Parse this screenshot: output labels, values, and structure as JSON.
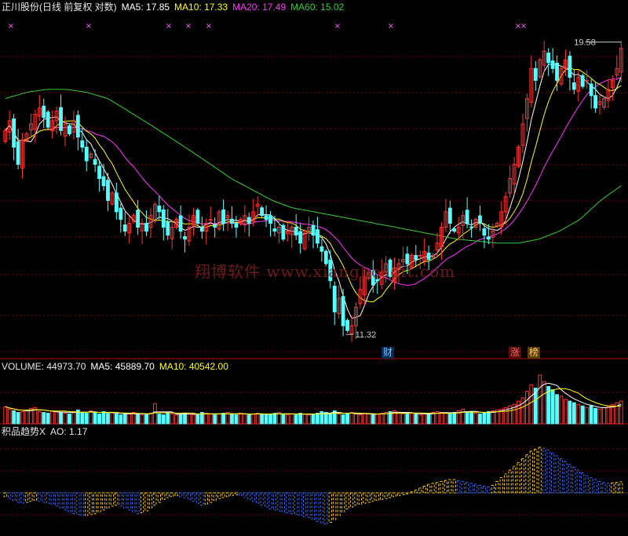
{
  "main_header": {
    "title": "正川股份(日线 前复权 对数)",
    "ma5": "MA5: 17.85",
    "ma10": "MA10: 17.33",
    "ma20": "MA20: 17.49",
    "ma60": "MA60: 15.02"
  },
  "volume_header": {
    "label": "VOLUME: 44973.70",
    "ma5": "MA5: 45889.70",
    "ma10": "MA10: 40542.00"
  },
  "ind_header": {
    "label": "积品趋势X",
    "ao": "AO: 1.17"
  },
  "watermark": "翔博软件 www.xiangbosoft.com",
  "badges": {
    "cai": "财",
    "zhang": "涨",
    "bang": "榜"
  },
  "colors": {
    "up": "#ff3333",
    "down": "#54ffff",
    "ma5": "#ffffff",
    "ma10": "#ffff00",
    "ma20": "#ff33ff",
    "ma60": "#33cc33",
    "grid": "#800000",
    "ao_pos": "#ffcc00",
    "ao_neg": "#3366ff"
  },
  "chart_data": [
    {
      "type": "candlestick",
      "title": "正川股份(日线 前复权 对数)",
      "annotations": [
        {
          "label": "19.58",
          "kind": "high"
        },
        {
          "label": "11.32",
          "kind": "low"
        }
      ],
      "y_range": [
        11.0,
        20.2
      ],
      "log_scale": true,
      "grid": true,
      "series_summary": [
        {
          "name": "MA5",
          "last": 17.85
        },
        {
          "name": "MA10",
          "last": 17.33
        },
        {
          "name": "MA20",
          "last": 17.49
        },
        {
          "name": "MA60",
          "last": 15.02
        }
      ],
      "closes": [
        16.6,
        16.9,
        16.1,
        15.6,
        16.3,
        16.5,
        16.8,
        17.1,
        17.3,
        17.0,
        16.7,
        16.9,
        17.2,
        16.6,
        16.8,
        16.5,
        16.9,
        16.4,
        16.1,
        15.7,
        15.9,
        15.6,
        15.2,
        15.0,
        14.6,
        14.8,
        14.3,
        14.1,
        13.8,
        14.0,
        14.2,
        13.9,
        14.0,
        13.8,
        14.2,
        14.5,
        14.3,
        13.9,
        13.7,
        13.9,
        14.1,
        13.8,
        13.6,
        13.9,
        14.2,
        14.0,
        13.8,
        14.0,
        14.1,
        13.9,
        14.3,
        14.0,
        14.2,
        14.0,
        13.9,
        14.1,
        14.2,
        14.0,
        14.3,
        14.5,
        14.2,
        14.1,
        14.0,
        13.8,
        13.9,
        13.6,
        13.8,
        13.9,
        13.7,
        13.5,
        13.8,
        13.9,
        13.7,
        13.5,
        13.3,
        13.0,
        12.6,
        11.9,
        12.2,
        11.6,
        11.5,
        11.6,
        12.0,
        12.4,
        12.7,
        12.8,
        12.5,
        12.6,
        12.8,
        13.0,
        12.7,
        12.9,
        13.0,
        13.1,
        13.0,
        13.2,
        13.1,
        13.2,
        13.3,
        13.1,
        13.2,
        13.5,
        13.9,
        14.3,
        14.0,
        13.8,
        13.9,
        14.2,
        14.0,
        13.9,
        14.1,
        14.0,
        13.7,
        13.6,
        13.8,
        14.0,
        14.3,
        14.7,
        15.2,
        15.6,
        16.1,
        16.8,
        17.6,
        18.6,
        18.2,
        18.9,
        19.2,
        18.8,
        18.6,
        18.2,
        18.6,
        18.9,
        18.3,
        17.9,
        18.3,
        18.0,
        18.2,
        17.7,
        17.3,
        17.5,
        17.6,
        17.9,
        18.2,
        18.6,
        19.3
      ]
    },
    {
      "type": "bar",
      "title": "VOLUME",
      "series_summary": [
        {
          "name": "VOLUME",
          "last": 44973.7
        },
        {
          "name": "MA5",
          "last": 45889.7
        },
        {
          "name": "MA10",
          "last": 40542.0
        }
      ],
      "values": [
        21,
        18,
        16,
        14,
        15,
        17,
        19,
        20,
        15,
        14,
        13,
        16,
        15,
        14,
        13,
        12,
        15,
        17,
        14,
        13,
        16,
        14,
        12,
        15,
        13,
        14,
        12,
        11,
        13,
        12,
        14,
        12,
        11,
        12,
        13,
        25,
        12,
        11,
        13,
        12,
        11,
        12,
        13,
        12,
        11,
        12,
        14,
        13,
        12,
        11,
        12,
        13,
        14,
        12,
        11,
        13,
        12,
        11,
        12,
        13,
        12,
        11,
        12,
        13,
        14,
        12,
        11,
        12,
        11,
        13,
        12,
        11,
        12,
        13,
        15,
        14,
        13,
        16,
        12,
        11,
        13,
        14,
        12,
        11,
        13,
        12,
        11,
        12,
        13,
        14,
        15,
        16,
        13,
        12,
        14,
        13,
        12,
        11,
        12,
        13,
        14,
        15,
        14,
        13,
        12,
        14,
        16,
        18,
        15,
        14,
        13,
        12,
        14,
        15,
        16,
        17,
        18,
        20,
        22,
        24,
        28,
        32,
        40,
        48,
        44,
        60,
        52,
        46,
        42,
        36,
        34,
        30,
        28,
        26,
        24,
        22,
        20,
        22,
        19,
        18,
        20,
        22,
        24,
        26,
        28
      ]
    },
    {
      "type": "bar",
      "title": "积品趋势X",
      "series_summary": [
        {
          "name": "AO",
          "last": 1.17
        }
      ],
      "values": [
        -0.4,
        -0.6,
        -0.8,
        -1.0,
        -1.1,
        -1.0,
        -0.9,
        -0.8,
        -0.9,
        -1.0,
        -1.1,
        -1.2,
        -1.4,
        -1.6,
        -1.8,
        -2.0,
        -2.2,
        -2.3,
        -2.4,
        -2.4,
        -2.3,
        -2.2,
        -2.0,
        -1.8,
        -1.6,
        -1.4,
        -1.3,
        -1.4,
        -1.6,
        -1.8,
        -2.0,
        -2.2,
        -2.1,
        -1.9,
        -1.6,
        -1.3,
        -1.0,
        -0.7,
        -0.5,
        -0.4,
        -0.3,
        -0.4,
        -0.5,
        -0.7,
        -0.9,
        -1.1,
        -1.3,
        -1.2,
        -1.0,
        -0.8,
        -0.6,
        -0.5,
        -0.4,
        -0.3,
        -0.2,
        -0.3,
        -0.5,
        -0.7,
        -0.9,
        -1.1,
        -1.3,
        -1.5,
        -1.7,
        -1.8,
        -1.9,
        -2.0,
        -2.1,
        -2.2,
        -2.3,
        -2.4,
        -2.5,
        -2.6,
        -2.8,
        -3.0,
        -3.2,
        -3.3,
        -3.1,
        -2.8,
        -2.4,
        -2.0,
        -1.7,
        -1.5,
        -1.3,
        -1.2,
        -1.1,
        -1.0,
        -0.9,
        -0.8,
        -0.7,
        -0.6,
        -0.5,
        -0.4,
        -0.3,
        -0.2,
        -0.1,
        0.1,
        0.3,
        0.5,
        0.7,
        0.9,
        1.0,
        1.1,
        1.2,
        1.3,
        1.4,
        1.4,
        1.3,
        1.2,
        1.1,
        1.0,
        0.9,
        0.8,
        0.7,
        0.6,
        0.8,
        1.2,
        1.6,
        2.0,
        2.4,
        2.8,
        3.2,
        3.6,
        4.0,
        4.4,
        4.6,
        4.8,
        4.7,
        4.5,
        4.2,
        3.9,
        3.6,
        3.3,
        3.0,
        2.7,
        2.4,
        2.1,
        1.8,
        1.6,
        1.4,
        1.2,
        1.1,
        1.0,
        1.05,
        1.1,
        1.17
      ]
    }
  ]
}
